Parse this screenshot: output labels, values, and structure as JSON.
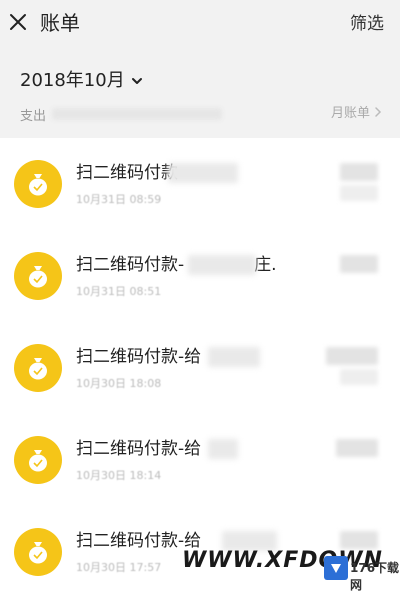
{
  "header": {
    "title": "账单",
    "filter_label": "筛选",
    "close_icon": "close-icon"
  },
  "month": {
    "label": "2018年10月",
    "expense_label": "支出",
    "monthly_bill_label": "月账单"
  },
  "transactions": [
    {
      "title": "扫二维码付款",
      "time": "10月31日 08:59"
    },
    {
      "title": "扫二维码付款-",
      "title_suffix": "庄.",
      "time": "10月31日 08:51"
    },
    {
      "title": "扫二维码付款-给",
      "time": "10月30日 18:08"
    },
    {
      "title": "扫二维码付款-给",
      "time": "10月30日 18:14"
    },
    {
      "title": "扫二维码付款-给",
      "time": "10月30日 17:57"
    }
  ],
  "watermark": {
    "text": "WWW.XFDOWN",
    "logo_text": "176下载网"
  },
  "colors": {
    "accent_yellow": "#f5c518",
    "header_bg": "#f2f2f2"
  }
}
